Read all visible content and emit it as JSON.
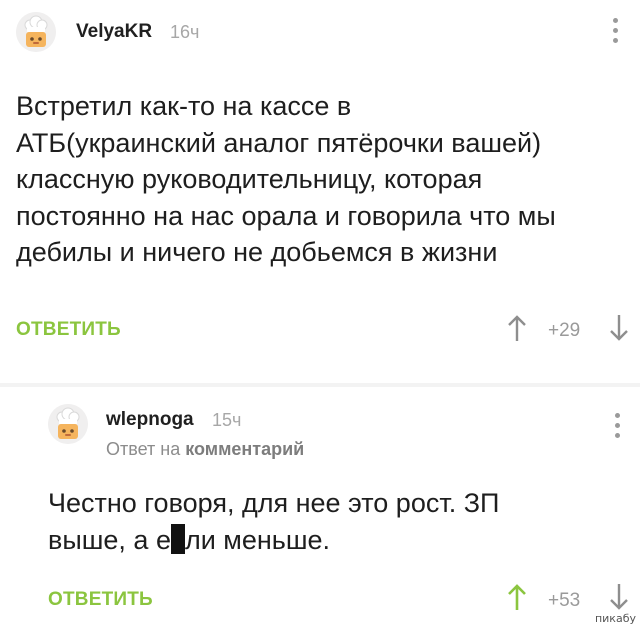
{
  "comments": [
    {
      "username": "VelyaKR",
      "time": "16ч",
      "text_lines": [
        "Встретил как-то на кассе в",
        "АТБ(украинский аналог пятёрочки вашей)",
        "классную руководительницу, которая",
        "постоянно на нас орала и говорила что мы",
        "дебилы и ничего не добьемся в жизни"
      ],
      "reply_label": "ОТВЕТИТЬ",
      "score": "+29"
    },
    {
      "username": "wlepnoga",
      "time": "15ч",
      "reply_to_prefix": "Ответ на",
      "reply_to_link": "комментарий",
      "text_line1": "Честно говоря, для нее это рост. ЗП",
      "text_line2_a": "выше, а е",
      "text_line2_b": "ли меньше.",
      "reply_label": "ОТВЕТИТЬ",
      "score": "+53"
    }
  ],
  "watermark": "пикабу",
  "colors": {
    "accent_green": "#8bc53f",
    "muted_gray": "#9a9a9a",
    "separator": "#f3f3f3"
  },
  "icons": {
    "avatar": "default-avatar-chef-hat-icon",
    "menu": "more-vertical-icon",
    "upvote": "arrow-up-icon",
    "downvote": "arrow-down-icon"
  }
}
